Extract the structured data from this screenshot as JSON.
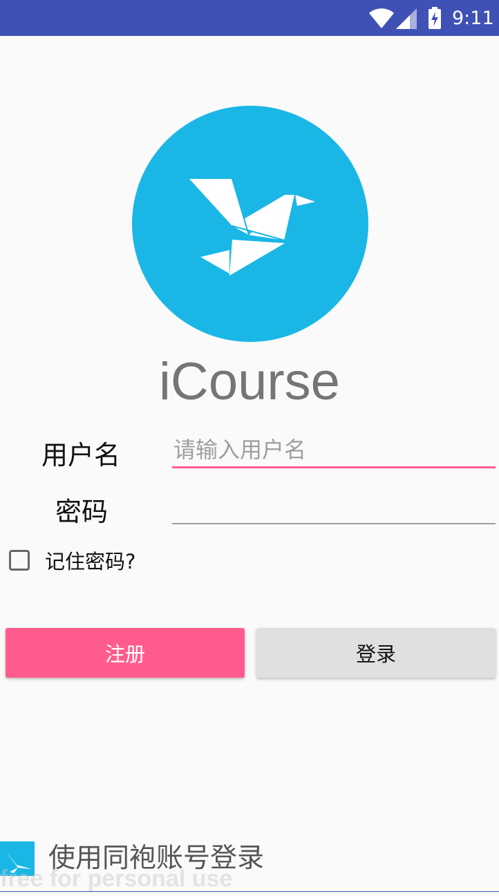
{
  "status_bar": {
    "time": "9:11",
    "icons": [
      "wifi-icon",
      "signal-icon",
      "battery-charging-icon"
    ],
    "background": "#3f51b5"
  },
  "logo": {
    "icon": "origami-bird-icon",
    "circle_color": "#1ab7e6"
  },
  "app_title": "iCourse",
  "form": {
    "username_label": "用户名",
    "username_placeholder": "请输入用户名",
    "username_value": "",
    "password_label": "密码",
    "password_value": "",
    "remember_label": "记住密码?",
    "remember_checked": false,
    "focus_color": "#ff5c8d"
  },
  "buttons": {
    "register_label": "注册",
    "login_label": "登录",
    "register_color": "#ff5c8d",
    "login_color": "#e0e0e0"
  },
  "sso": {
    "label": "使用同袍账号登录",
    "icon": "swallow-logo-icon"
  },
  "watermark": "free for personal use"
}
